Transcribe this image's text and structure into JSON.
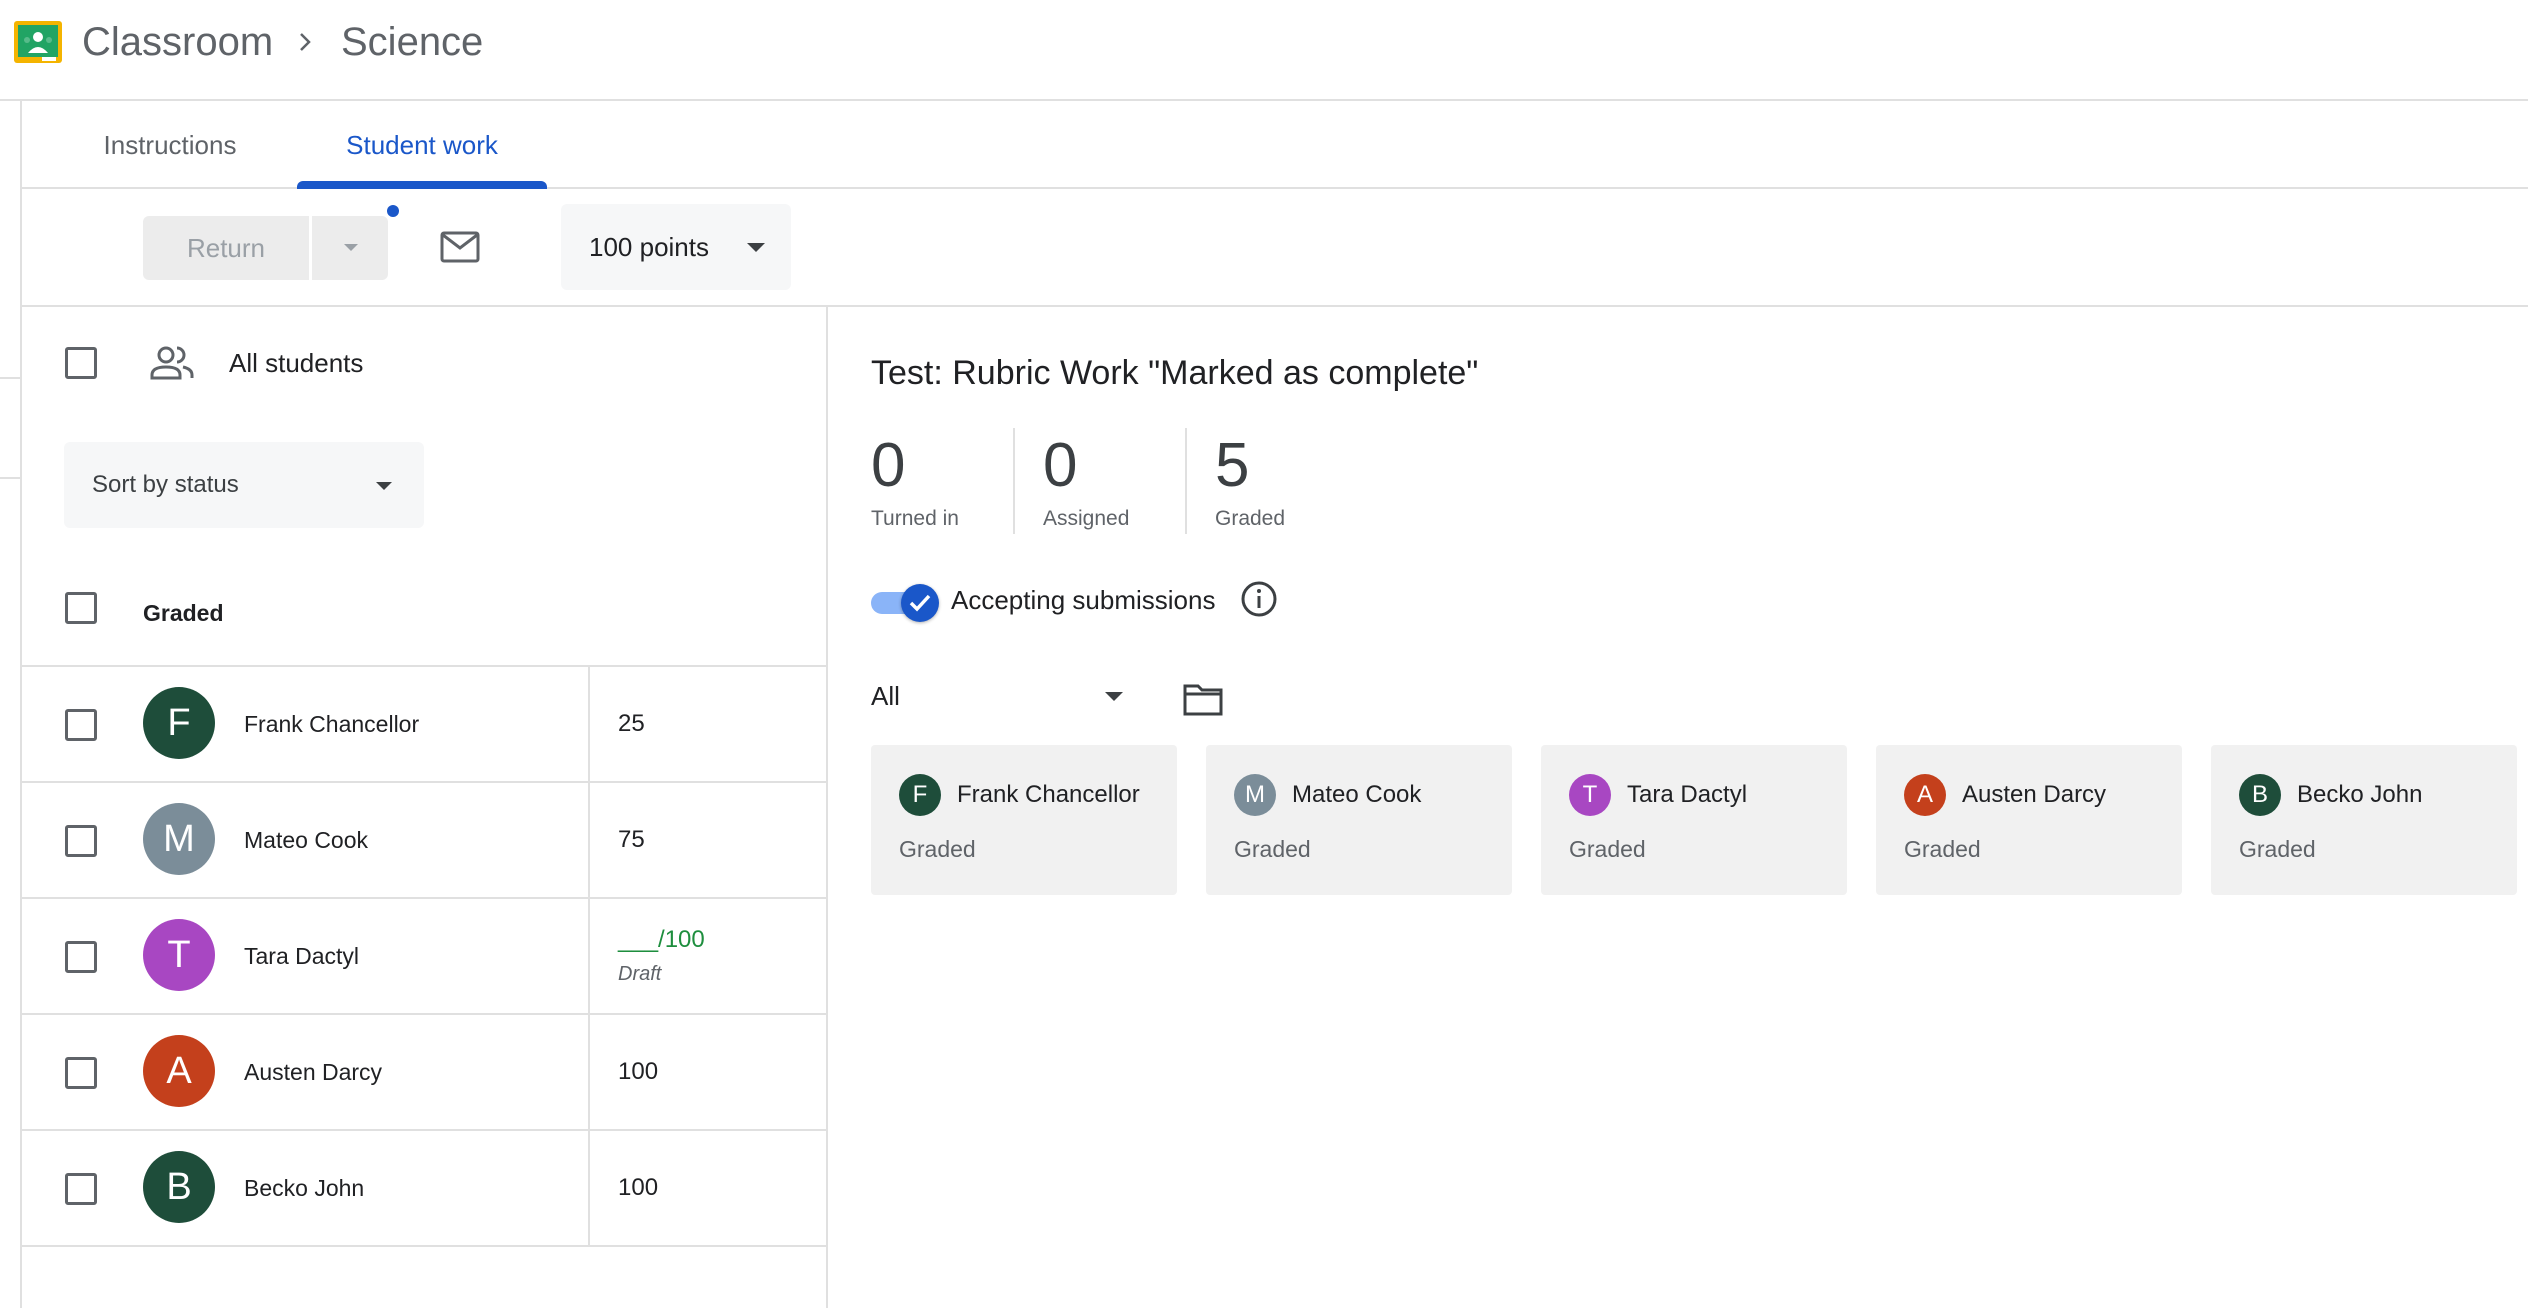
{
  "header": {
    "breadcrumb": [
      "Classroom",
      "Science"
    ]
  },
  "tabs": [
    {
      "label": "Instructions",
      "active": false
    },
    {
      "label": "Student work",
      "active": true
    }
  ],
  "toolbar": {
    "return_label": "Return",
    "points_label": "100 points"
  },
  "left_panel": {
    "all_students_label": "All students",
    "sort_label": "Sort by status",
    "group_header": "Graded",
    "students": [
      {
        "initial": "F",
        "name": "Frank Chancellor",
        "grade": "25",
        "color": "#1e4d3a"
      },
      {
        "initial": "M",
        "name": "Mateo Cook",
        "grade": "75",
        "color": "#7b8d99"
      },
      {
        "initial": "T",
        "name": "Tara Dactyl",
        "grade": "___/100",
        "draft_label": "Draft",
        "color": "#a847c2"
      },
      {
        "initial": "A",
        "name": "Austen Darcy",
        "grade": "100",
        "color": "#c4401c"
      },
      {
        "initial": "B",
        "name": "Becko John",
        "grade": "100",
        "color": "#1e4d3a"
      }
    ]
  },
  "right_panel": {
    "title": "Test: Rubric Work \"Marked as complete\"",
    "stats": [
      {
        "value": "0",
        "label": "Turned in"
      },
      {
        "value": "0",
        "label": "Assigned"
      },
      {
        "value": "5",
        "label": "Graded"
      }
    ],
    "accepting_label": "Accepting submissions",
    "filter_label": "All",
    "cards": [
      {
        "initial": "F",
        "name": "Frank Chancellor",
        "status": "Graded",
        "color": "#1e4d3a"
      },
      {
        "initial": "M",
        "name": "Mateo Cook",
        "status": "Graded",
        "color": "#7b8d99"
      },
      {
        "initial": "T",
        "name": "Tara Dactyl",
        "status": "Graded",
        "color": "#a847c2"
      },
      {
        "initial": "A",
        "name": "Austen Darcy",
        "status": "Graded",
        "color": "#c4401c"
      },
      {
        "initial": "B",
        "name": "Becko John",
        "status": "Graded",
        "color": "#1e4d3a"
      }
    ]
  }
}
